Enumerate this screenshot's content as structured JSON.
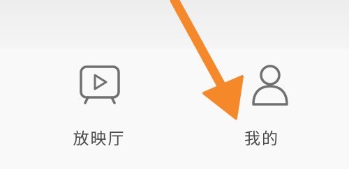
{
  "bottom_nav": {
    "items": [
      {
        "label": "放映厅",
        "icon": "tv-play-icon"
      },
      {
        "label": "我的",
        "icon": "person-icon"
      }
    ]
  },
  "annotation": {
    "arrow_color": "#f5892a",
    "icon_color": "#707070"
  }
}
